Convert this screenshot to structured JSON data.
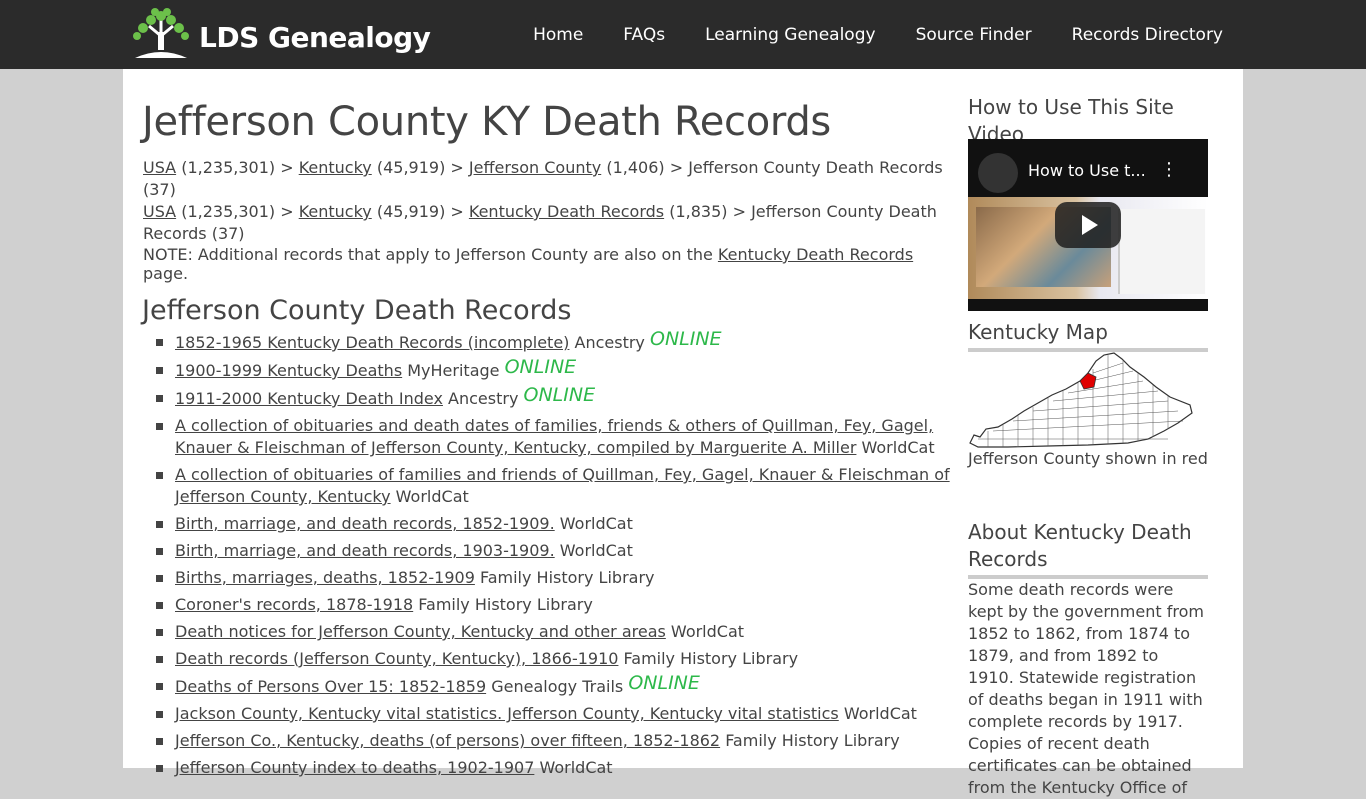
{
  "brand": {
    "name": "LDS Genealogy"
  },
  "nav": [
    "Home",
    "FAQs",
    "Learning Genealogy",
    "Source Finder",
    "Records Directory"
  ],
  "title": "Jefferson County KY Death Records",
  "breadcrumbs": [
    {
      "usa": "USA",
      "usa_count": " (1,235,301) > ",
      "state": "Kentucky",
      "state_count": " (45,919) > ",
      "mid": "Jefferson County",
      "mid_count": " (1,406) > ",
      "tail": "Jefferson County Death Records (37)"
    },
    {
      "usa": "USA",
      "usa_count": " (1,235,301) > ",
      "state": "Kentucky",
      "state_count": " (45,919) > ",
      "mid": "Kentucky Death Records",
      "mid_count": " (1,835) > ",
      "tail": "Jefferson County Death Records (37)"
    }
  ],
  "note": {
    "prefix": "NOTE: Additional records that apply to Jefferson County are also on the ",
    "link": "Kentucky Death Records",
    "suffix": " page."
  },
  "section_title": "Jefferson County Death Records",
  "records": [
    {
      "link": "1852-1965 Kentucky Death Records (incomplete)",
      "source": " Ancestry",
      "online": "ONLINE"
    },
    {
      "link": "1900-1999 Kentucky Deaths",
      "source": " MyHeritage",
      "online": "ONLINE"
    },
    {
      "link": "1911-2000 Kentucky Death Index",
      "source": " Ancestry",
      "online": "ONLINE"
    },
    {
      "link": "A collection of obituaries and death dates of families, friends & others of Quillman, Fey, Gagel, Knauer & Fleischman of Jefferson County, Kentucky, compiled by Marguerite A. Miller",
      "source": " WorldCat",
      "online": ""
    },
    {
      "link": "A collection of obituaries of families and friends of Quillman, Fey, Gagel, Knauer & Fleischman of Jefferson County, Kentucky",
      "source": " WorldCat",
      "online": ""
    },
    {
      "link": "Birth, marriage, and death records, 1852-1909.",
      "source": " WorldCat",
      "online": ""
    },
    {
      "link": "Birth, marriage, and death records, 1903-1909.",
      "source": " WorldCat",
      "online": ""
    },
    {
      "link": "Births, marriages, deaths, 1852-1909",
      "source": " Family History Library",
      "online": ""
    },
    {
      "link": "Coroner's records, 1878-1918",
      "source": " Family History Library",
      "online": ""
    },
    {
      "link": "Death notices for Jefferson County, Kentucky and other areas",
      "source": " WorldCat",
      "online": ""
    },
    {
      "link": "Death records (Jefferson County, Kentucky), 1866-1910",
      "source": " Family History Library",
      "online": ""
    },
    {
      "link": "Deaths of Persons Over 15: 1852-1859",
      "source": " Genealogy Trails",
      "online": "ONLINE"
    },
    {
      "link": "Jackson County, Kentucky vital statistics. Jefferson County, Kentucky vital statistics",
      "source": " WorldCat",
      "online": ""
    },
    {
      "link": "Jefferson Co., Kentucky, deaths (of persons) over fifteen, 1852-1862",
      "source": " Family History Library",
      "online": ""
    },
    {
      "link": "Jefferson County index to deaths, 1902-1907",
      "source": " WorldCat",
      "online": ""
    }
  ],
  "sidebar": {
    "video_heading": "How to Use This Site Video",
    "video_title": "How to Use t...",
    "map_heading": "Kentucky Map",
    "map_caption": "Jefferson County shown in red",
    "about_heading": "About Kentucky Death Records",
    "about_text": "Some death records were kept by the government from 1852 to 1862, from 1874 to 1879, and from 1892 to 1910. Statewide registration of deaths began in 1911 with complete records by 1917. Copies of recent death certificates can be obtained from the Kentucky Office of"
  },
  "colors": {
    "topbar": "#2b2b2b",
    "online": "#2db84a",
    "highlight": "#e00000"
  }
}
